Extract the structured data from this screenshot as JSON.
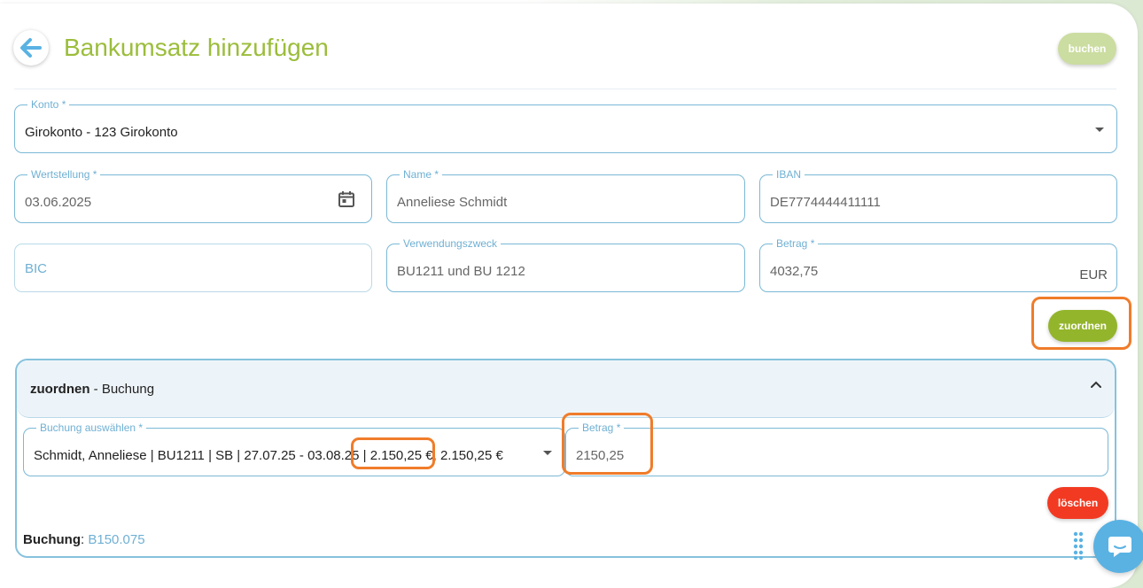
{
  "header": {
    "title": "Bankumsatz hinzufügen",
    "book_button": "buchen"
  },
  "form": {
    "konto": {
      "label": "Konto *",
      "value": "Girokonto - 123 Girokonto"
    },
    "wertstellung": {
      "label": "Wertstellung *",
      "value": "03.06.2025"
    },
    "name": {
      "label": "Name *",
      "value": "Anneliese Schmidt"
    },
    "iban": {
      "label": "IBAN",
      "value": "DE7774444411111"
    },
    "bic": {
      "placeholder": "BIC"
    },
    "verwendungszweck": {
      "label": "Verwendungszweck",
      "value": "BU1211 und BU 1212"
    },
    "betrag": {
      "label": "Betrag *",
      "value": "4032,75",
      "unit": "EUR"
    },
    "assign_button": "zuordnen"
  },
  "assignment": {
    "title_bold": "zuordnen",
    "title_rest": " - Buchung",
    "select": {
      "label": "Buchung auswählen *",
      "value_prefix": "Schmidt, Anneliese | BU1211 | SB | 27.07.25 - 03.08.25 | ",
      "value_amount": "2.150,25 €",
      "value_suffix": ", 2.150,25 €"
    },
    "betrag": {
      "label": "Betrag *",
      "value": "2150,25"
    },
    "delete_button": "löschen",
    "buchung_label": "Buchung",
    "buchung_sep": ": ",
    "buchung_value": "B150.075"
  },
  "colors": {
    "accent_green": "#93b52c",
    "title_green": "#9bbd3b",
    "field_blue": "#7ab8d6",
    "highlight_orange": "#f07c2a",
    "delete_red": "#f23a22"
  },
  "icons": [
    "arrow-left-icon",
    "calendar-icon",
    "caret-down-icon",
    "chevron-up-icon",
    "drag-handle-icon",
    "chat-icon"
  ]
}
